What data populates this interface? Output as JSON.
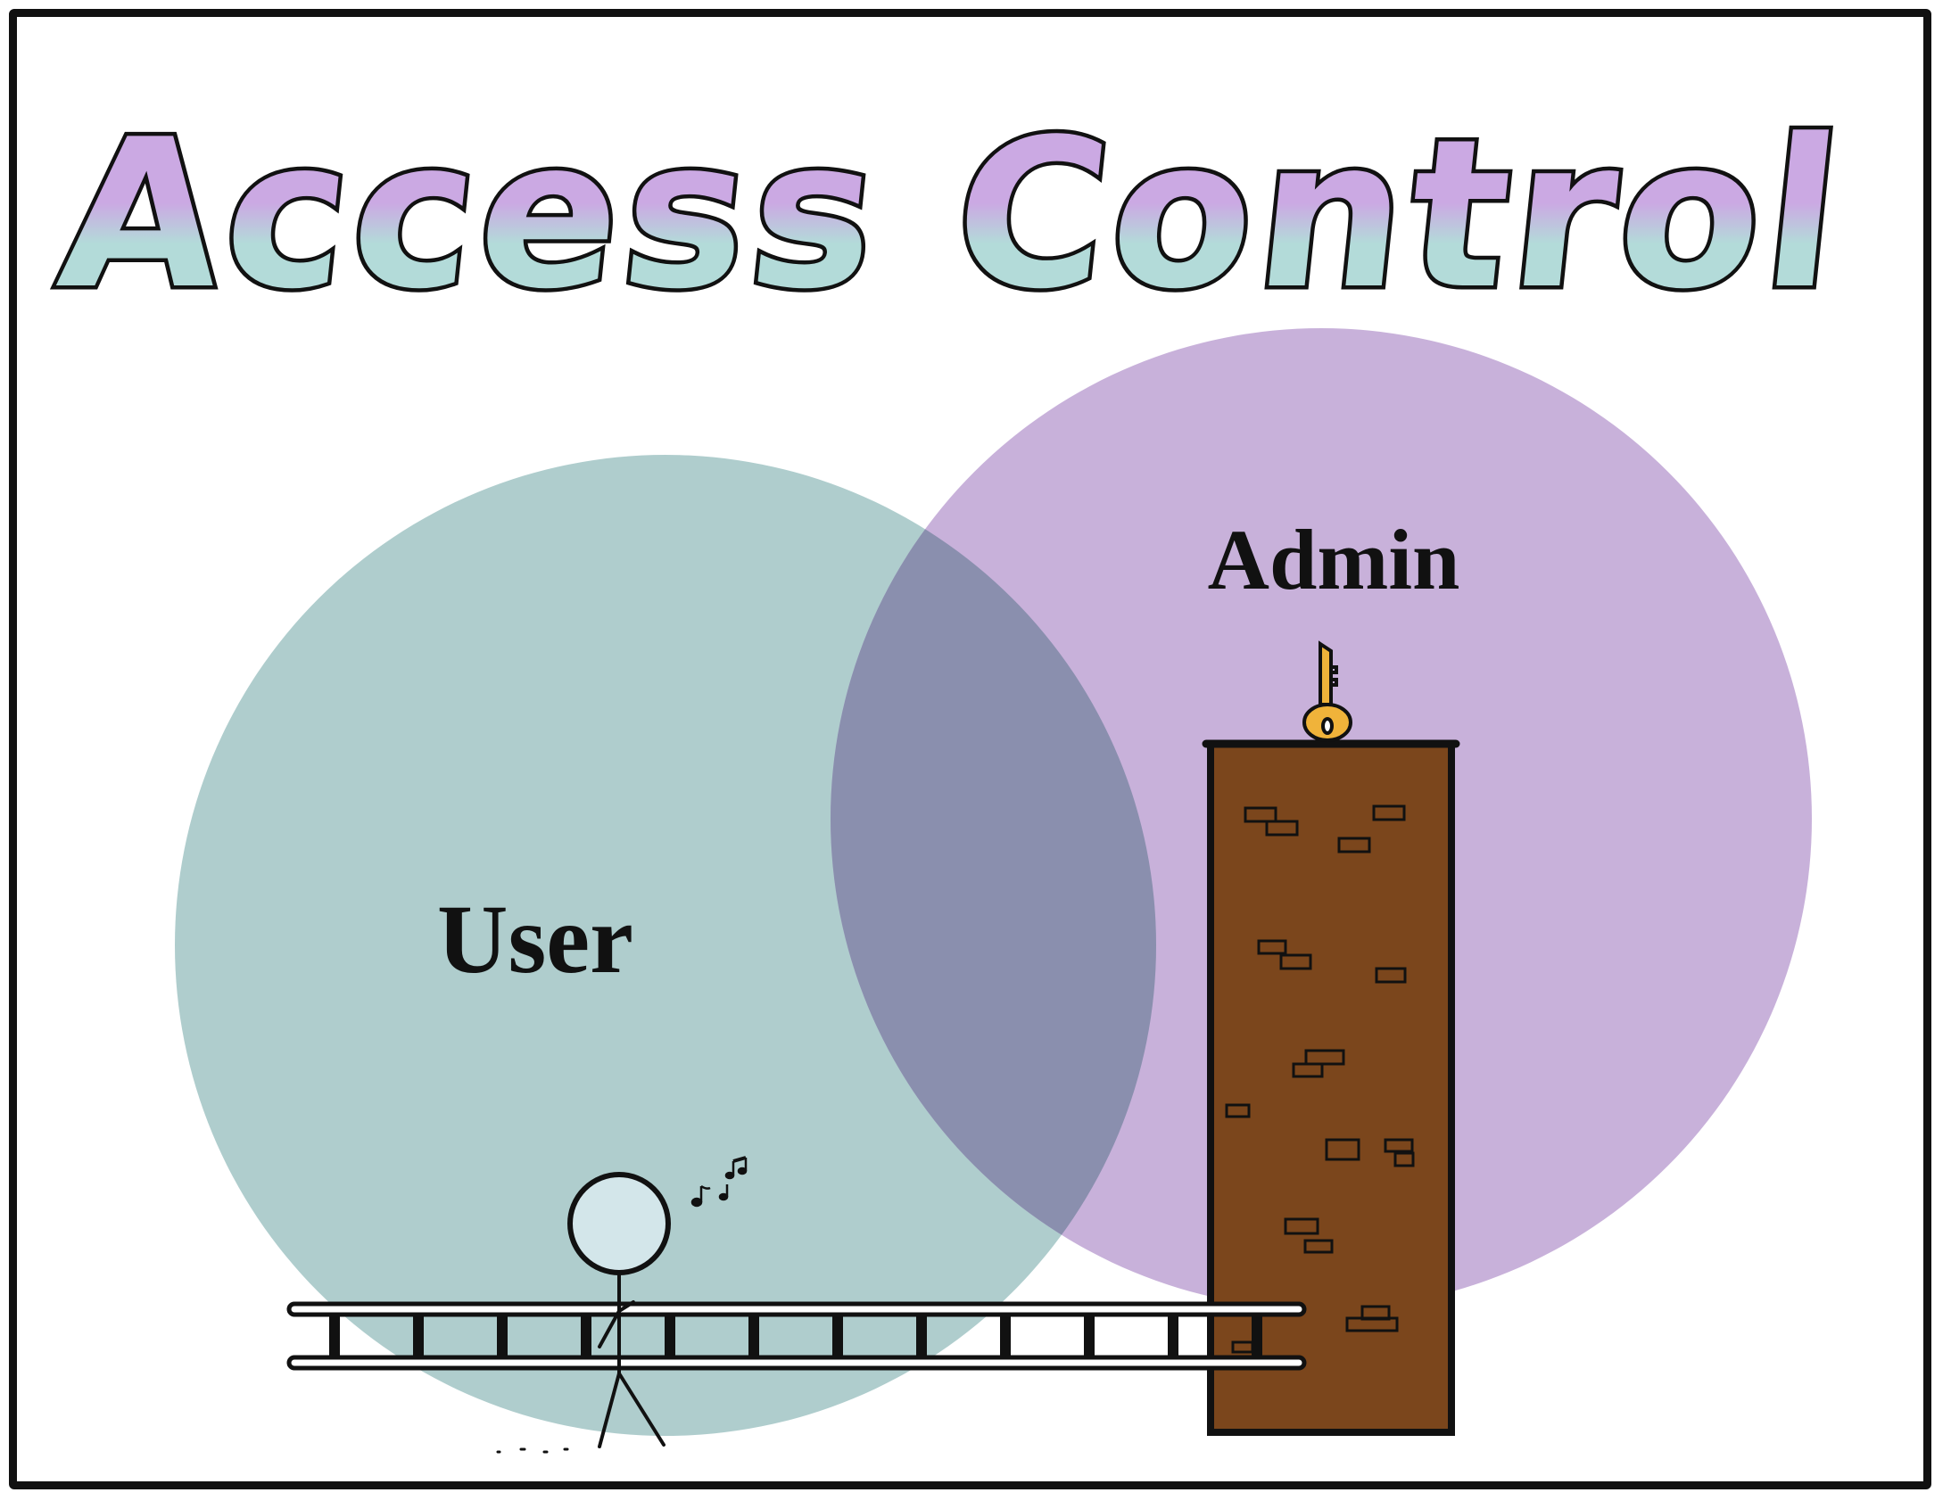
{
  "title": "Access Control",
  "regions": {
    "user": {
      "label": "User"
    },
    "admin": {
      "label": "Admin"
    }
  },
  "colors": {
    "user_circle": "#a6c8c8",
    "admin_circle": "#c2a9d6",
    "overlap": "#8a8fae",
    "title_top": "#cba9e3",
    "title_bottom": "#b3dbd9",
    "tower": "#7b461c",
    "key": "#f0b33a",
    "stick_head": "#d3e6ea",
    "border": "#111111"
  },
  "icons": {
    "person": "stick-figure-icon",
    "key": "key-icon",
    "ladder": "ladder-icon",
    "tower": "brick-tower-icon",
    "music": "music-notes-icon"
  }
}
